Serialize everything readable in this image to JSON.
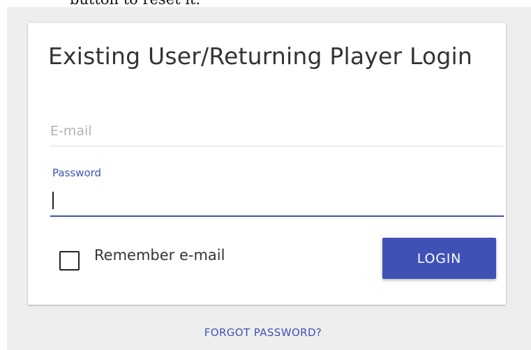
{
  "background_text": "button to reset it.",
  "login": {
    "title": "Existing User/Returning Player Login",
    "email_placeholder": "E-mail",
    "email_value": "",
    "password_label": "Password",
    "password_value": "",
    "remember_label": "Remember e-mail",
    "remember_checked": false,
    "login_button_label": "LOGIN",
    "forgot_password_label": "FORGOT PASSWORD?"
  },
  "colors": {
    "accent": "#3f51b5",
    "page_background": "#eeeeee",
    "card_background": "#ffffff",
    "title_text": "#333333"
  }
}
